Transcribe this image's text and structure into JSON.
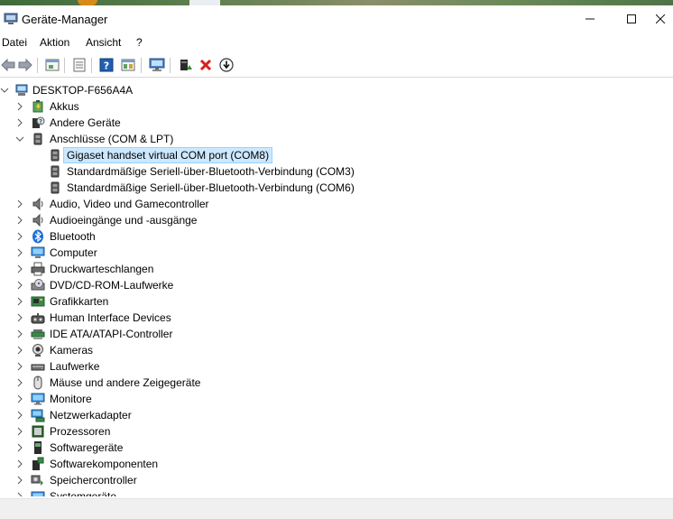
{
  "window": {
    "title": "Geräte-Manager",
    "controls": [
      "minimize",
      "maximize",
      "close"
    ]
  },
  "menu": {
    "items": [
      "Datei",
      "Aktion",
      "Ansicht",
      "?"
    ]
  },
  "toolbar": {
    "buttons": [
      "back-arrow-icon",
      "forward-arrow-icon",
      "properties-icon",
      "show-hidden-icon",
      "help-icon",
      "view-icon",
      "monitor-icon",
      "update-driver-icon",
      "uninstall-icon",
      "download-icon"
    ],
    "colors": {
      "uninstall": "#d81e1e",
      "help": "#1f5fb3",
      "update": "#2f8f2f"
    }
  },
  "tree": {
    "root": "DESKTOP-F656A4A",
    "nodes": [
      {
        "label": "Akkus",
        "icon": "battery-icon",
        "expanded": false
      },
      {
        "label": "Andere Geräte",
        "icon": "unknown-device-icon",
        "expanded": false
      },
      {
        "label": "Anschlüsse (COM & LPT)",
        "icon": "port-icon",
        "expanded": true,
        "children": [
          {
            "label": "Gigaset handset virtual COM port (COM8)",
            "icon": "port-icon",
            "selected": true
          },
          {
            "label": "Standardmäßige Seriell-über-Bluetooth-Verbindung (COM3)",
            "icon": "port-icon",
            "selected": false
          },
          {
            "label": "Standardmäßige Seriell-über-Bluetooth-Verbindung (COM6)",
            "icon": "port-icon",
            "selected": false
          }
        ]
      },
      {
        "label": "Audio, Video und Gamecontroller",
        "icon": "speaker-icon",
        "expanded": false
      },
      {
        "label": "Audioeingänge und -ausgänge",
        "icon": "speaker-icon",
        "expanded": false
      },
      {
        "label": "Bluetooth",
        "icon": "bluetooth-icon",
        "expanded": false
      },
      {
        "label": "Computer",
        "icon": "computer-icon",
        "expanded": false
      },
      {
        "label": "Druckwarteschlangen",
        "icon": "printer-icon",
        "expanded": false
      },
      {
        "label": "DVD/CD-ROM-Laufwerke",
        "icon": "disc-drive-icon",
        "expanded": false
      },
      {
        "label": "Grafikkarten",
        "icon": "display-adapter-icon",
        "expanded": false
      },
      {
        "label": "Human Interface Devices",
        "icon": "hid-icon",
        "expanded": false
      },
      {
        "label": "IDE ATA/ATAPI-Controller",
        "icon": "ide-controller-icon",
        "expanded": false
      },
      {
        "label": "Kameras",
        "icon": "camera-icon",
        "expanded": false
      },
      {
        "label": "Laufwerke",
        "icon": "hard-drive-icon",
        "expanded": false
      },
      {
        "label": "Mäuse und andere Zeigegeräte",
        "icon": "mouse-icon",
        "expanded": false
      },
      {
        "label": "Monitore",
        "icon": "monitor-icon",
        "expanded": false
      },
      {
        "label": "Netzwerkadapter",
        "icon": "network-adapter-icon",
        "expanded": false
      },
      {
        "label": "Prozessoren",
        "icon": "processor-icon",
        "expanded": false
      },
      {
        "label": "Softwaregeräte",
        "icon": "software-device-icon",
        "expanded": false
      },
      {
        "label": "Softwarekomponenten",
        "icon": "software-component-icon",
        "expanded": false
      },
      {
        "label": "Speichercontroller",
        "icon": "storage-controller-icon",
        "expanded": false
      },
      {
        "label": "Systemgeräte",
        "icon": "system-device-icon",
        "expanded": false
      }
    ]
  },
  "colors": {
    "selection_bg": "#cce8ff",
    "selection_border": "#99d1ff"
  }
}
